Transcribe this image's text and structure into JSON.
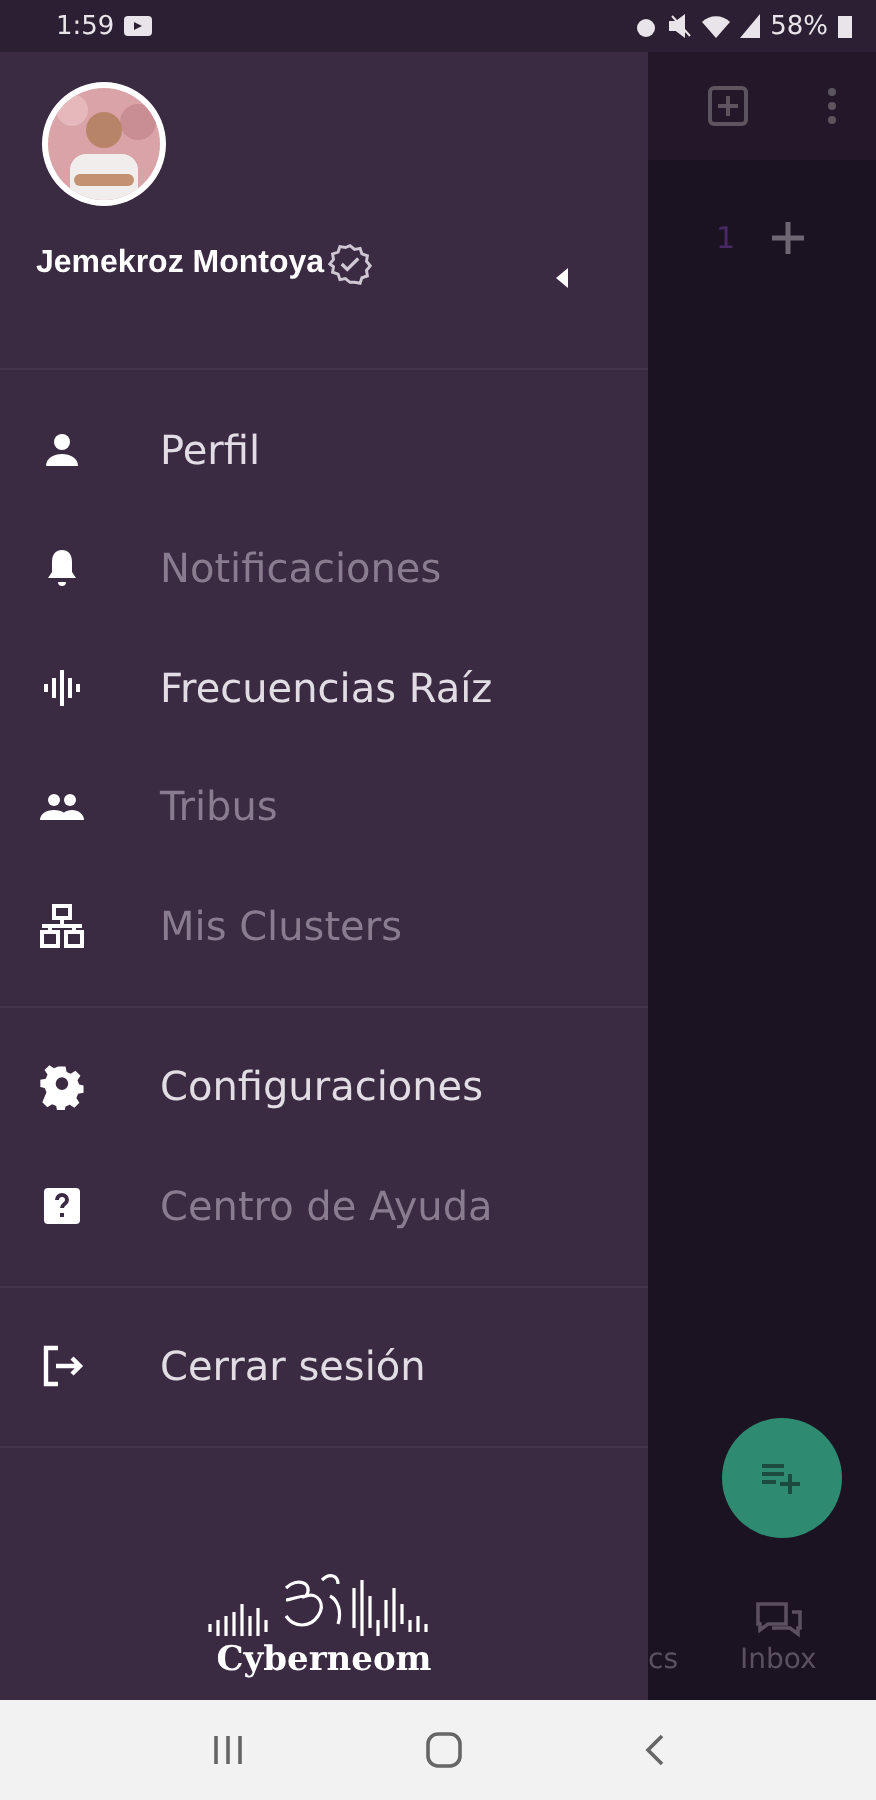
{
  "status_bar": {
    "time": "1:59",
    "battery": "58%"
  },
  "drawer": {
    "user": {
      "name": "Jemekroz Montoya",
      "verified": true
    },
    "groups": [
      {
        "items": [
          {
            "label": "Perfil",
            "kind": "person",
            "disabled": false
          },
          {
            "label": "Notificaciones",
            "kind": "bell",
            "disabled": true
          },
          {
            "label": "Frecuencias Raíz",
            "kind": "wave",
            "disabled": false
          },
          {
            "label": "Tribus",
            "kind": "group",
            "disabled": true
          },
          {
            "label": "Mis Clusters",
            "kind": "network",
            "disabled": true
          }
        ]
      },
      {
        "items": [
          {
            "label": "Configuraciones",
            "kind": "gear",
            "disabled": false
          },
          {
            "label": "Centro de Ayuda",
            "kind": "help",
            "disabled": true
          }
        ]
      },
      {
        "items": [
          {
            "label": "Cerrar sesión",
            "kind": "logout",
            "disabled": false
          }
        ]
      }
    ],
    "logo": {
      "text": "Cyberneom"
    }
  },
  "background": {
    "count": "1",
    "tabs": [
      "cs",
      "Inbox"
    ]
  }
}
